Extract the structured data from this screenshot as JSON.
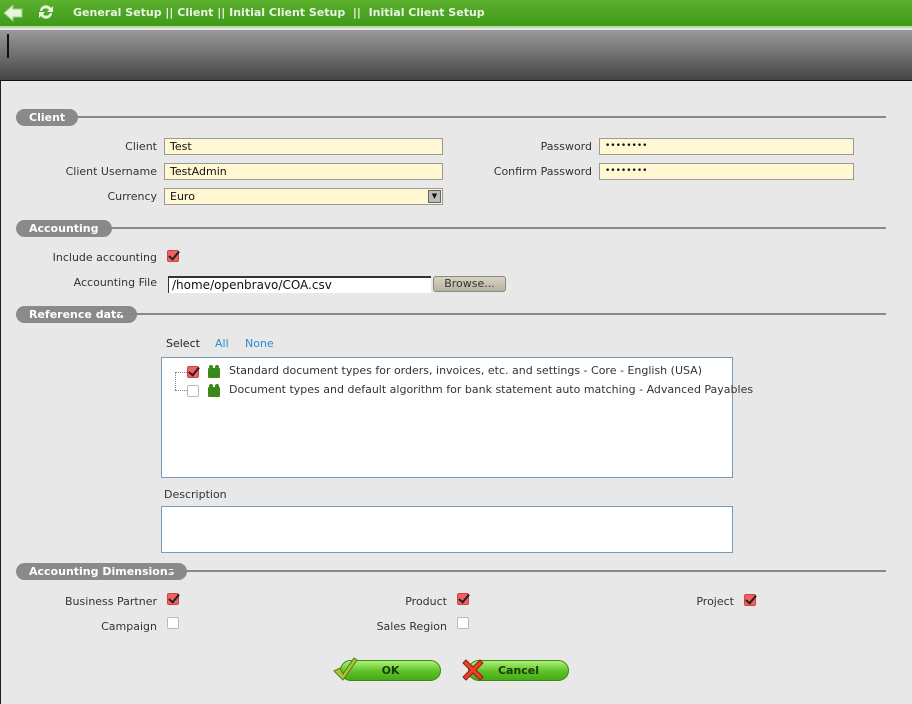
{
  "header": {
    "breadcrumb": "General Setup || Client || Initial Client Setup  ||  Initial Client Setup",
    "back_icon": "back-arrow-icon",
    "refresh_icon": "refresh-icon"
  },
  "sections": {
    "client": "Client",
    "accounting": "Accounting",
    "reference": "Reference data",
    "dimensions": "Accounting Dimensions"
  },
  "client": {
    "client_label": "Client",
    "client_value": "Test",
    "username_label": "Client Username",
    "username_value": "TestAdmin",
    "currency_label": "Currency",
    "currency_value": "Euro",
    "password_label": "Password",
    "password_value": "••••••••",
    "confirm_label": "Confirm Password",
    "confirm_value": "••••••••"
  },
  "accounting": {
    "include_label": "Include accounting",
    "include_checked": true,
    "file_label": "Accounting File",
    "file_value": "/home/openbravo/COA.csv",
    "browse_label": "Browse..."
  },
  "reference": {
    "select_label": "Select",
    "all_label": "All",
    "none_label": "None",
    "items": [
      {
        "label": "Standard document types for orders, invoices, etc. and settings - Core - English (USA)",
        "checked": true
      },
      {
        "label": "Document types and default algorithm for bank statement auto matching - Advanced Payables",
        "checked": false
      }
    ],
    "description_label": "Description"
  },
  "dimensions": {
    "business_partner": "Business Partner",
    "product": "Product",
    "project": "Project",
    "campaign": "Campaign",
    "sales_region": "Sales Region"
  },
  "buttons": {
    "ok": "OK",
    "cancel": "Cancel"
  }
}
